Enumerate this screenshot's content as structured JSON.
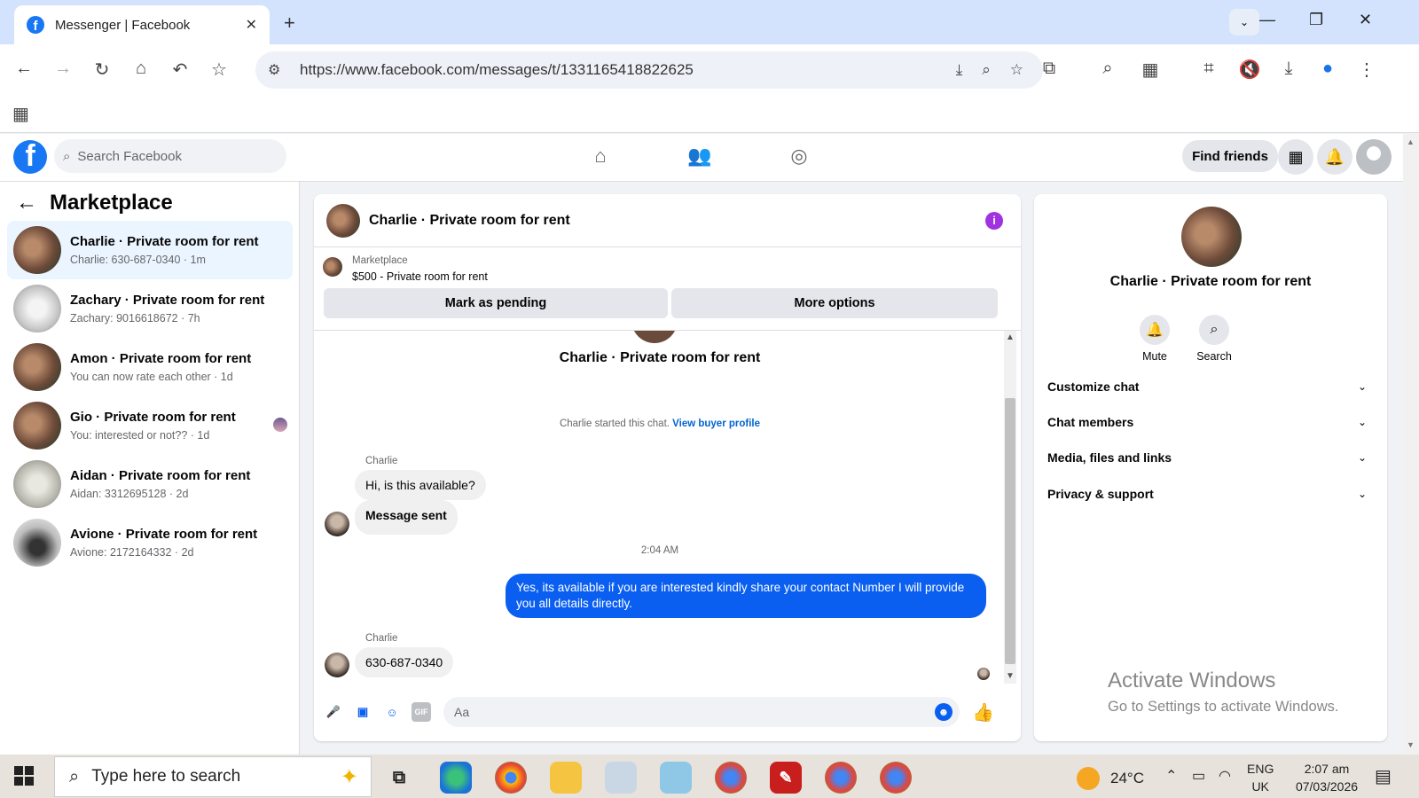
{
  "browser": {
    "tab_title": "Messenger | Facebook",
    "url": "https://www.facebook.com/messages/t/1331165418822625"
  },
  "fb": {
    "search_placeholder": "Search Facebook",
    "find_friends": "Find friends",
    "brand_color": "#1877f2"
  },
  "sidebar": {
    "title": "Marketplace",
    "conversations": [
      {
        "name": "Charlie · Private room for rent",
        "preview": "Charlie: 630-687-0340 · 1m",
        "active": true
      },
      {
        "name": "Zachary · Private room for rent",
        "preview": "Zachary: 9016618672 · 7h"
      },
      {
        "name": "Amon · Private room for rent",
        "preview": "You can now rate each other · 1d"
      },
      {
        "name": "Gio · Private room for rent",
        "preview": "You: interested or not?? · 1d"
      },
      {
        "name": "Aidan · Private room for rent",
        "preview": "Aidan: 3312695128 · 2d"
      },
      {
        "name": "Avione · Private room for rent",
        "preview": "Avione: 2172164332 · 2d"
      }
    ]
  },
  "chat": {
    "header_title": "Charlie · Private room for rent",
    "info_icon": "i",
    "marketplace_label": "Marketplace",
    "listing": "$500 - Private room for rent",
    "mark_pending": "Mark as pending",
    "more_options": "More options",
    "conversation_title": "Charlie · Private room for rent",
    "started_text": "Charlie started this chat.",
    "view_profile": "View buyer profile",
    "messages": [
      {
        "sender": "Charlie",
        "text": "Hi, is this available?"
      },
      {
        "text": "Message sent"
      },
      {
        "timestamp": "2:04 AM"
      },
      {
        "text": "Yes, its available if you are interested kindly share your contact Number I will provide you all details directly."
      },
      {
        "sender": "Charlie",
        "text": "630-687-0340"
      }
    ],
    "composer_placeholder": "Aa",
    "gif_label": "GIF",
    "accent_color": "#0a5ff1"
  },
  "info": {
    "name": "Charlie · Private room for rent",
    "mute": "Mute",
    "search": "Search",
    "sections": [
      "Customize chat",
      "Chat members",
      "Media, files and links",
      "Privacy & support"
    ],
    "watermark_line1": "Activate Windows",
    "watermark_line2": "Go to Settings to activate Windows."
  },
  "taskbar": {
    "search_placeholder": "Type here to search",
    "temperature": "24°C",
    "lang1": "ENG",
    "lang2": "UK",
    "time": "2:07 am",
    "date": "07/03/2026"
  }
}
